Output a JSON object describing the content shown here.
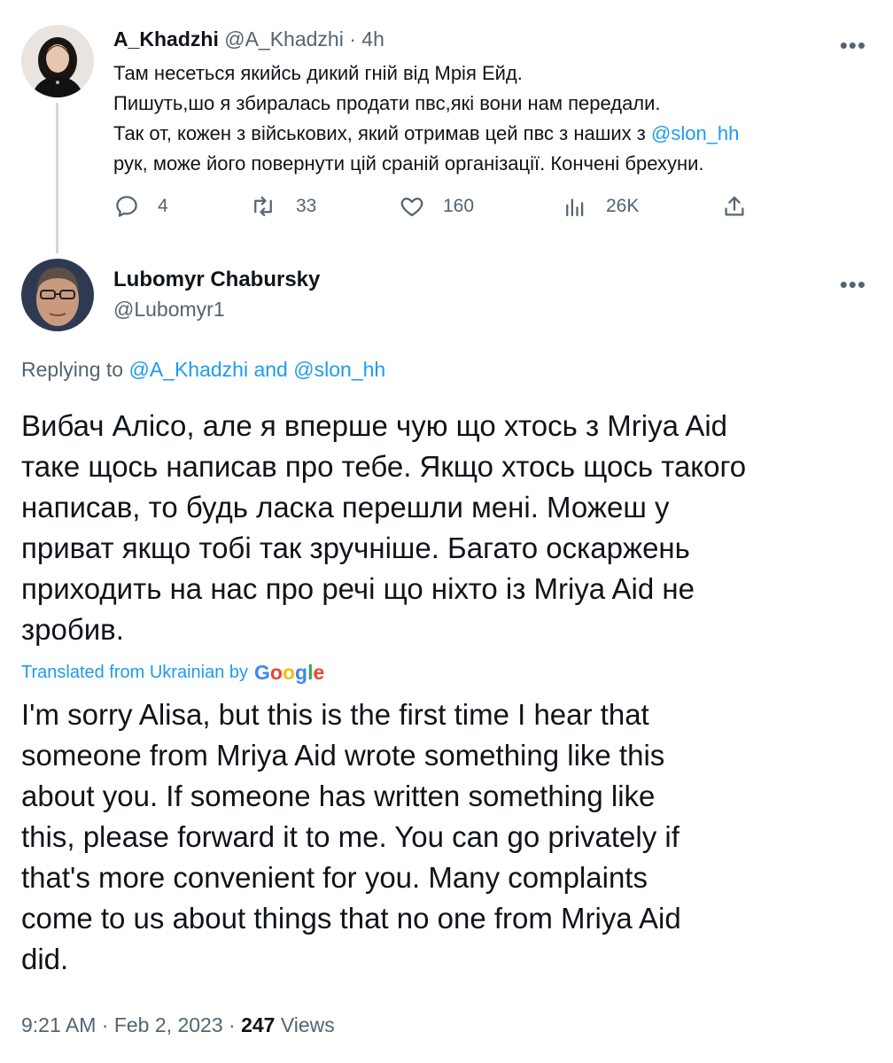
{
  "tweet1": {
    "display_name": "A_Khadzhi",
    "handle": "@A_Khadzhi",
    "separator": "·",
    "time": "4h",
    "more": "•••",
    "lines": [
      "Там несеться якийсь дикий гній від Мрія Ейд.",
      "Пишуть,шо я збиралась продати пвс,які вони нам передали.",
      "Так от, кожен з військових, який отримав цей пвс з наших з",
      "рук, може його повернути цій сраній організації. Кончені брехуни."
    ],
    "mention": "@slon_hh",
    "actions": {
      "reply_count": "4",
      "retweet_count": "33",
      "like_count": "160",
      "views_count": "26K"
    }
  },
  "tweet2": {
    "display_name": "Lubomyr Chabursky",
    "handle": "@Lubomyr1",
    "more": "•••",
    "replying_prefix": "Replying to",
    "replying_user1": "@A_Khadzhi",
    "replying_and": "and",
    "replying_user2": "@slon_hh",
    "ua_lines": [
      "Вибач Алісо, але я вперше чую що хтось з Mriya Aid",
      "таке щось написав про тебе. Якщо хтось щось такого",
      "написав, то будь ласка перешли мені. Можеш у",
      "приват якщо тобі так зручніше. Багато оскаржень",
      "приходить на нас про речі що ніхто із Mriya Aid не",
      "зробив."
    ],
    "translated_label": "Translated from Ukrainian by",
    "google_letters": [
      "G",
      "o",
      "o",
      "g",
      "l",
      "e"
    ],
    "en_lines": [
      "I'm sorry Alisa, but this is the first time I hear that",
      "someone from Mriya Aid wrote something like this",
      "about you. If someone has written something like",
      "this, please forward it to me. You can go privately if",
      "that's more convenient for you. Many complaints",
      "come to us about things that no one from Mriya Aid",
      "did."
    ],
    "time": "9:21 AM",
    "dot1": "·",
    "date": "Feb 2, 2023",
    "dot2": "·",
    "views_count": "247",
    "views_label": "Views"
  },
  "colors": {
    "link": "#1d9bf0",
    "muted": "#536471",
    "text": "#0f1419",
    "google": [
      "#4285F4",
      "#EA4335",
      "#FBBC05",
      "#4285F4",
      "#34A853",
      "#EA4335"
    ]
  }
}
